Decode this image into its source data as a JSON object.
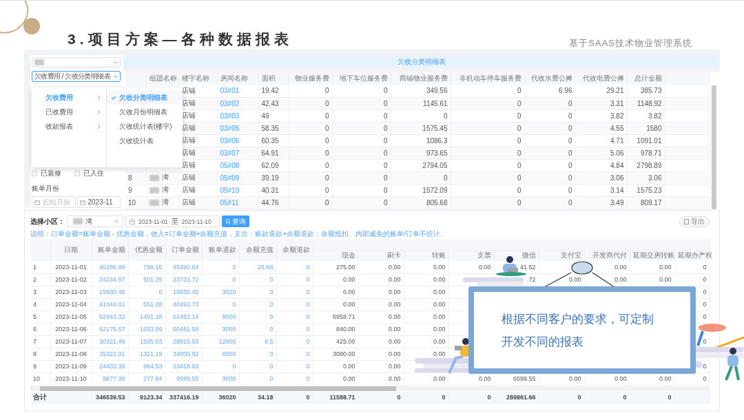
{
  "slide": {
    "title": "3.项目方案—各种数据报表",
    "subtitle": "基于SAAS技术物业管理系统"
  },
  "arrears_panel": {
    "community_select": {
      "redacted": true
    },
    "report_cascader": {
      "value": "欠收费用 / 欠收分类明细表",
      "expanded": true
    },
    "cascader_menu": {
      "categories": [
        {
          "label": "欠收费用",
          "selected": true
        },
        {
          "label": "已收费用",
          "selected": false
        },
        {
          "label": "收款报表",
          "selected": false
        }
      ],
      "reports": [
        {
          "label": "欠收分类明细表",
          "selected": true
        },
        {
          "label": "欠收月份明细表",
          "selected": false
        },
        {
          "label": "欠收统计表(楼宇)",
          "selected": false
        },
        {
          "label": "欠收统计表",
          "selected": false
        }
      ]
    },
    "checkboxes": [
      {
        "label": "已装修",
        "checked": false
      },
      {
        "label": "已入住",
        "checked": false
      }
    ],
    "bill_month": {
      "label": "账单月份",
      "start": {
        "placeholder": "起始月份"
      },
      "end": {
        "value": "2023-11"
      }
    },
    "report_title": "欠收分类明细表",
    "table": {
      "columns": [
        {
          "label": "组团名称",
          "kind": "text"
        },
        {
          "label": "楼宇名称",
          "kind": "text"
        },
        {
          "label": "房间名称",
          "kind": "link"
        },
        {
          "label": "面积",
          "kind": "text"
        },
        {
          "label": "物业服务费",
          "kind": "number"
        },
        {
          "label": "地下车位服务费",
          "kind": "number"
        },
        {
          "label": "商铺物业服务费",
          "kind": "number"
        },
        {
          "label": "非机动车停车服务费",
          "kind": "number"
        },
        {
          "label": "代收水费公摊",
          "kind": "number"
        },
        {
          "label": "代收电费公摊",
          "kind": "number"
        },
        {
          "label": "总计金额",
          "kind": "number"
        }
      ],
      "rows": [
        {
          "index": null,
          "redacted": false,
          "cells": [
            null,
            "店铺",
            "03#01",
            "19.42",
            "0",
            "0",
            "349.56",
            "0",
            "6.96",
            "29.21",
            "385.73"
          ]
        },
        {
          "index": null,
          "redacted": false,
          "cells": [
            null,
            "店铺",
            "03#02",
            "42.43",
            "0",
            "0",
            "1145.61",
            "0",
            "0",
            "3.31",
            "1148.92"
          ]
        },
        {
          "index": null,
          "redacted": false,
          "cells": [
            null,
            "店铺",
            "03#03",
            "49",
            "0",
            "0",
            "0",
            "0",
            "0",
            "3.82",
            "3.82"
          ]
        },
        {
          "index": null,
          "redacted": false,
          "cells": [
            null,
            "店铺",
            "03#05",
            "58.35",
            "0",
            "0",
            "1575.45",
            "0",
            "0",
            "4.55",
            "1580"
          ]
        },
        {
          "index": null,
          "redacted": false,
          "cells": [
            null,
            "店铺",
            "03#06",
            "60.35",
            "0",
            "0",
            "1086.3",
            "0",
            "0",
            "4.71",
            "1091.01"
          ]
        },
        {
          "index": null,
          "redacted": false,
          "cells": [
            null,
            "店铺",
            "03#07",
            "64.91",
            "0",
            "0",
            "973.65",
            "0",
            "0",
            "5.06",
            "978.71"
          ]
        },
        {
          "index": null,
          "redacted": false,
          "cells": [
            null,
            "店铺",
            "05#08",
            "62.09",
            "0",
            "0",
            "2794.05",
            "0",
            "0",
            "4.84",
            "2798.89"
          ]
        },
        {
          "index": "8",
          "redacted": true,
          "cells": [
            "湾",
            "店铺",
            "05#09",
            "39.19",
            "0",
            "0",
            "0",
            "0",
            "0",
            "3.06",
            "3.06"
          ]
        },
        {
          "index": "9",
          "redacted": true,
          "cells": [
            "湾",
            "店铺",
            "05#10",
            "40.31",
            "0",
            "0",
            "1572.09",
            "0",
            "0",
            "3.14",
            "1575.23"
          ]
        },
        {
          "index": "10",
          "redacted": true,
          "cells": [
            "湾",
            "店铺",
            "05#11",
            "44.76",
            "0",
            "0",
            "805.68",
            "0",
            "0",
            "3.49",
            "809.17"
          ]
        }
      ]
    }
  },
  "payments_panel": {
    "community_label": "选择小区：",
    "community_select": {
      "value": "湾",
      "redacted": true
    },
    "date_range": {
      "start": "2023-11-01",
      "separator": "至",
      "end": "2023-11-10"
    },
    "query_button": "查询",
    "export_button": "导出",
    "note": "说明：订单金额=账单金额 - 优惠金额，收入=订单金额+余额充值，支出：账款退款+余额退款；余额抵扣、内部减免的账单/订单不统计。",
    "table": {
      "columns": [
        {
          "label": "日期",
          "kind": "date"
        },
        {
          "label": "账单金额",
          "kind": "link_amount"
        },
        {
          "label": "优惠金额",
          "kind": "link_amount"
        },
        {
          "label": "订单金额",
          "kind": "link_amount"
        },
        {
          "label": "账单退款",
          "kind": "link_amount"
        },
        {
          "label": "余额充值",
          "kind": "link_amount"
        },
        {
          "label": "余额退款",
          "kind": "link_amount"
        },
        {
          "label": "现金",
          "kind": "amount"
        },
        {
          "label": "刷卡",
          "kind": "amount"
        },
        {
          "label": "转账",
          "kind": "amount"
        },
        {
          "label": "支票",
          "kind": "amount"
        },
        {
          "label": "微信",
          "kind": "amount"
        },
        {
          "label": "支付宝",
          "kind": "amount"
        },
        {
          "label": "开发商代付",
          "kind": "amount"
        },
        {
          "label": "延期交房转账",
          "kind": "amount"
        },
        {
          "label": "延期办产权",
          "kind": "amount"
        }
      ],
      "rows": [
        {
          "index": "1",
          "cells": [
            "2023-11-01",
            "46286.99",
            "796.15",
            "45490.84",
            "0",
            "25.68",
            "0",
            "275.00",
            "0.00",
            "0.00",
            "0.00",
            "41.52",
            null,
            "0.00",
            "0.00",
            "0"
          ]
        },
        {
          "index": "2",
          "cells": [
            "2023-11-02",
            "24234.97",
            "501.25",
            "23733.72",
            "0",
            "0",
            "0",
            "0.00",
            "0.00",
            "0.00",
            null,
            ".72",
            "0.00",
            "0.00",
            "0.00",
            "0"
          ]
        },
        {
          "index": "3",
          "cells": [
            "2023-11-03",
            "19930.45",
            "0",
            "19930.45",
            "3020",
            "0",
            "0",
            "0.00",
            "0.00",
            "0.00",
            null,
            null,
            null,
            null,
            null,
            "0"
          ]
        },
        {
          "index": "4",
          "cells": [
            "2023-11-04",
            "41044.01",
            "551.28",
            "40492.73",
            "0",
            "0",
            "0",
            "0.00",
            "0.00",
            "0.00",
            null,
            null,
            null,
            null,
            null,
            "0"
          ]
        },
        {
          "index": "5",
          "cells": [
            "2023-11-05",
            "52943.32",
            "1491.18",
            "51452.14",
            "9000",
            "0",
            "0",
            "6958.71",
            "0.00",
            "0.00",
            null,
            null,
            null,
            null,
            null,
            "0"
          ]
        },
        {
          "index": "6",
          "cells": [
            "2023-11-06",
            "62175.57",
            "1693.99",
            "60481.58",
            "3000",
            "0",
            "0",
            "840.00",
            "0.00",
            "0.00",
            null,
            null,
            null,
            null,
            null,
            null
          ]
        },
        {
          "index": "7",
          "cells": [
            "2023-11-07",
            "30321.46",
            "1505.93",
            "28815.53",
            "12000",
            "8.5",
            "0",
            "425.00",
            "0.00",
            "0.00",
            null,
            null,
            null,
            null,
            null,
            "0"
          ]
        },
        {
          "index": "8",
          "cells": [
            "2023-11-08",
            "35322.01",
            "1321.19",
            "34000.82",
            "6000",
            "0",
            "0",
            "3090.00",
            "0.00",
            "0.00",
            null,
            null,
            null,
            null,
            null,
            null
          ]
        },
        {
          "index": "9",
          "cells": [
            "2023-11-09",
            "24403.36",
            "984.53",
            "23418.83",
            "0",
            "0",
            "0",
            "0.00",
            "0.00",
            null,
            null,
            null,
            null,
            null,
            null,
            "0"
          ]
        },
        {
          "index": "10",
          "cells": [
            "2023-11-10",
            "9877.39",
            "277.84",
            "9599.55",
            "3000",
            "0",
            "0",
            "0.00",
            "0.00",
            "0.00",
            "0.00",
            "6599.55",
            "0.00",
            "0.00",
            "0.00",
            "0"
          ]
        }
      ],
      "total": {
        "label": "合计",
        "cells": [
          null,
          "346539.53",
          "9123.34",
          "337416.19",
          "36020",
          "34.18",
          "0",
          "11588.71",
          "0",
          "0",
          "0",
          "289861.66",
          "0",
          "0",
          "0",
          null
        ]
      }
    }
  },
  "callout": {
    "lines": [
      "根据不同客户的要求，可定制",
      "开发不同的报表"
    ]
  }
}
